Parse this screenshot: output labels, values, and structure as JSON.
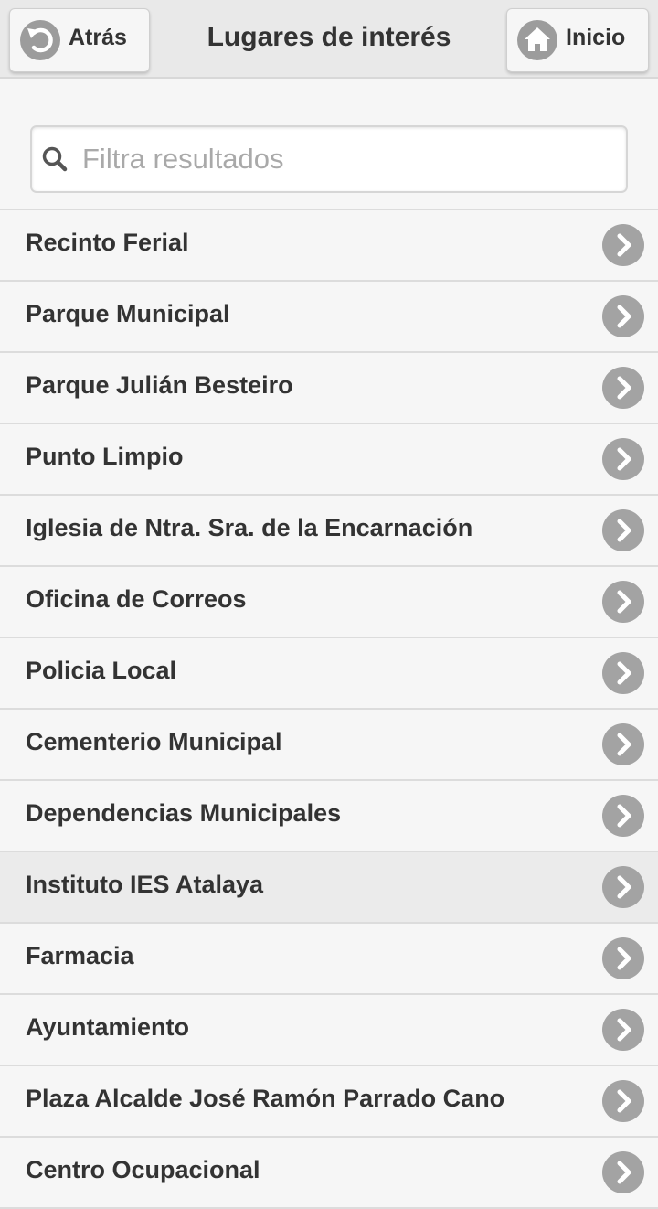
{
  "header": {
    "title": "Lugares de interés",
    "back_label": "Atrás",
    "home_label": "Inicio"
  },
  "search": {
    "placeholder": "Filtra resultados",
    "value": ""
  },
  "places": [
    {
      "label": "Recinto Ferial"
    },
    {
      "label": "Parque Municipal"
    },
    {
      "label": "Parque Julián Besteiro"
    },
    {
      "label": "Punto Limpio"
    },
    {
      "label": "Iglesia de Ntra. Sra. de la Encarnación"
    },
    {
      "label": "Oficina de Correos"
    },
    {
      "label": "Policia Local"
    },
    {
      "label": "Cementerio Municipal"
    },
    {
      "label": "Dependencias Municipales"
    },
    {
      "label": "Instituto IES Atalaya"
    },
    {
      "label": "Farmacia"
    },
    {
      "label": "Ayuntamiento"
    },
    {
      "label": "Plaza Alcalde José Ramón Parrado Cano"
    },
    {
      "label": "Centro Ocupacional"
    }
  ],
  "icons": {
    "back": "back-arrow-icon",
    "home": "home-icon",
    "search": "search-icon",
    "row_arrow": "chevron-right-icon"
  },
  "colors": {
    "header_bg": "#e9e9e9",
    "list_bg": "#f6f6f6",
    "active_row_bg": "#ebebeb",
    "icon_bg": "#a3a3a3",
    "text": "#333333"
  }
}
